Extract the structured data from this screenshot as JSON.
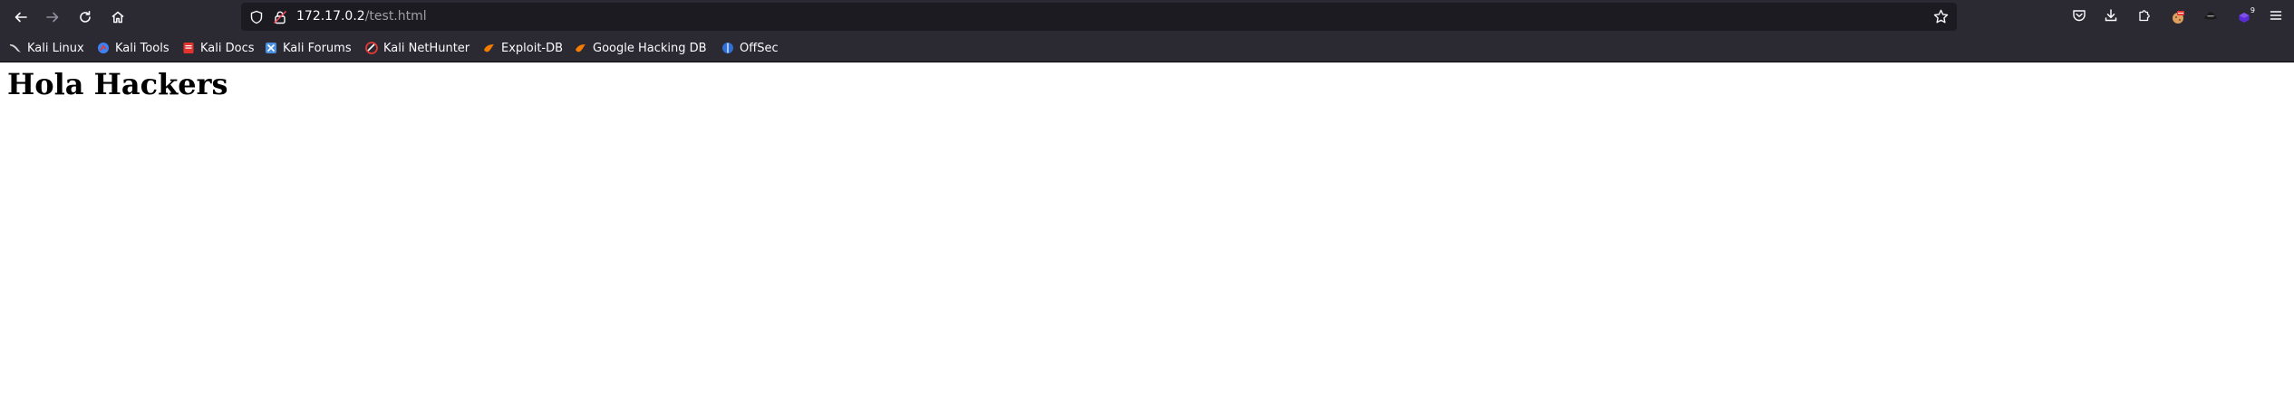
{
  "browser": {
    "url_host": "172.17.0.2",
    "url_path": "/test.html",
    "toolbar_icons": {
      "back": "back-arrow-icon",
      "forward": "forward-arrow-icon",
      "reload": "reload-icon",
      "home": "home-icon",
      "shield": "shield-icon",
      "lock": "lock-insecure-icon",
      "bookmark_star": "star-icon",
      "pocket": "pocket-icon",
      "downloads": "download-icon",
      "extensions": "puzzle-icon",
      "menu": "hamburger-menu-icon"
    },
    "extension_badge": "9"
  },
  "bookmarks": [
    {
      "label": "Kali Linux",
      "icon": "kali-dragon-icon",
      "color": "#367bf0"
    },
    {
      "label": "Kali Tools",
      "icon": "kali-tools-icon",
      "color": "#3b82f6"
    },
    {
      "label": "Kali Docs",
      "icon": "kali-docs-icon",
      "color": "#e3342f"
    },
    {
      "label": "Kali Forums",
      "icon": "kali-forums-icon",
      "color": "#4a90e2"
    },
    {
      "label": "Kali NetHunter",
      "icon": "nethunter-icon",
      "color": "#e53935"
    },
    {
      "label": "Exploit-DB",
      "icon": "exploit-db-icon",
      "color": "#f57c00"
    },
    {
      "label": "Google Hacking DB",
      "icon": "ghdb-icon",
      "color": "#f57c00"
    },
    {
      "label": "OffSec",
      "icon": "offsec-icon",
      "color": "#2f6fd6"
    }
  ],
  "page": {
    "heading": "Hola Hackers"
  },
  "colors": {
    "chrome_bg": "#2b2a33",
    "urlbar_bg": "#1c1b22",
    "page_bg": "#ffffff"
  }
}
